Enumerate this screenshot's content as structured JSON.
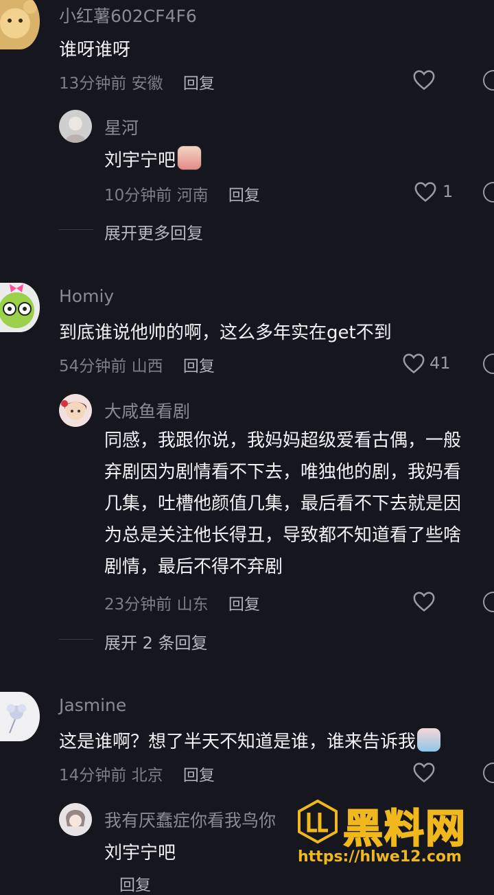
{
  "comments": [
    {
      "user": "小红薯602CF4F6",
      "text": "谁呀谁呀",
      "time": "13分钟前",
      "location": "安徽",
      "reply": "回复",
      "likes": ""
    },
    {
      "user": "星河",
      "text": "刘宇宁吧",
      "emoji": "crying-face",
      "time": "10分钟前",
      "location": "河南",
      "reply": "回复",
      "likes": "1"
    },
    {
      "expand": "展开更多回复"
    },
    {
      "user": "Homiy",
      "text": "到底谁说他帅的啊，这么多年实在get不到",
      "time": "54分钟前",
      "location": "山西",
      "reply": "回复",
      "likes": "41"
    },
    {
      "user": "大咸鱼看剧",
      "lines": [
        "同感，我跟你说，我妈妈超级爱看古偶，一般",
        "弃剧因为剧情看不下去，唯独他的剧，我妈看",
        "几集，吐槽他颜值几集，最后看不下去就是因",
        "为总是关注他长得丑，导致都不知道看了些啥",
        "剧情，最后不得不弃剧"
      ],
      "time": "23分钟前",
      "location": "山东",
      "reply": "回复",
      "likes": ""
    },
    {
      "expand": "展开 2 条回复"
    },
    {
      "user": "Jasmine",
      "text": "这是谁啊？想了半天不知道是谁，谁来告诉我",
      "emoji": "weeping-face",
      "time": "14分钟前",
      "location": "北京",
      "reply": "回复",
      "likes": ""
    },
    {
      "user": "我有厌蠢症你看我鸟你",
      "text": "刘宇宁吧",
      "time": "",
      "location": "",
      "reply": "回复"
    }
  ],
  "watermark": {
    "brand": "黑料网",
    "url": "https://hlwe12.com"
  },
  "colors": {
    "background": "#16161e",
    "watermark_gold": "#f0b81c"
  }
}
